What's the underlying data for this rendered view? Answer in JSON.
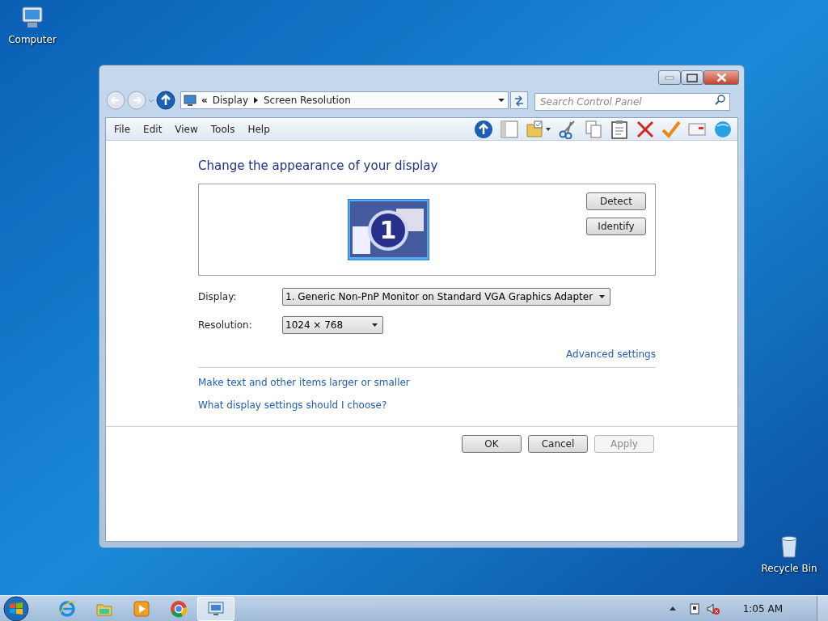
{
  "desktop_icons": [
    {
      "kind": "computer",
      "label": "Computer"
    },
    {
      "kind": "recycle",
      "label": "Recycle Bin"
    }
  ],
  "window": {
    "address": {
      "prefix": "«",
      "crumbs": [
        "Display",
        "Screen Resolution"
      ]
    },
    "search": {
      "placeholder": "Search Control Panel"
    },
    "menu": [
      "File",
      "Edit",
      "View",
      "Tools",
      "Help"
    ],
    "toolbar": [
      {
        "kind": "up"
      },
      {
        "kind": "pane"
      },
      {
        "kind": "folder"
      },
      {
        "kind": "cut"
      },
      {
        "kind": "copy"
      },
      {
        "kind": "paste"
      },
      {
        "kind": "delete"
      },
      {
        "kind": "check"
      },
      {
        "kind": "mail"
      },
      {
        "kind": "globe"
      }
    ],
    "heading": "Change the appearance of your display",
    "monitor_number": "1",
    "side_buttons": [
      "Detect",
      "Identify"
    ],
    "fields": [
      {
        "label": "Display:",
        "value": "1. Generic Non-PnP Monitor on Standard VGA Graphics Adapter"
      },
      {
        "label": "Resolution:",
        "value": "1024 × 768"
      }
    ],
    "advanced_link": "Advanced settings",
    "links": [
      "Make text and other items larger or smaller",
      "What display settings should I choose?"
    ],
    "dialog_buttons": [
      {
        "label": "OK",
        "disabled": false
      },
      {
        "label": "Cancel",
        "disabled": false
      },
      {
        "label": "Apply",
        "disabled": true
      }
    ]
  },
  "taskbar": {
    "apps": [
      {
        "kind": "ie",
        "selected": false
      },
      {
        "kind": "explorer",
        "selected": false
      },
      {
        "kind": "media",
        "selected": false
      },
      {
        "kind": "chrome",
        "selected": false
      },
      {
        "kind": "display",
        "selected": true
      }
    ],
    "clock": "1:05 AM"
  }
}
